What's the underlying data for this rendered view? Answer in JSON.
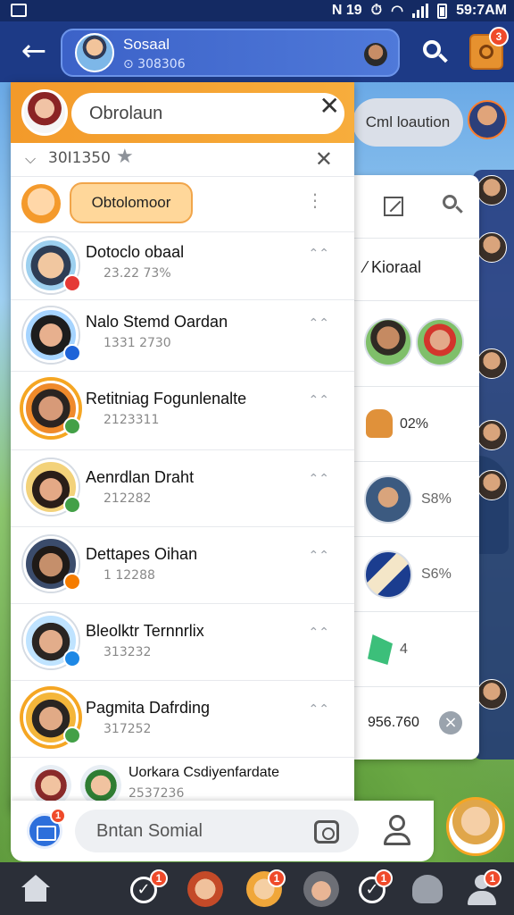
{
  "status_bar": {
    "right_text": "N 19",
    "time": "59:7AM"
  },
  "top_bar": {
    "back_icon": "arrow-left-icon",
    "chat_title": "Sosaal",
    "chat_subtitle": "⊙ 308306",
    "notification_badge": "3"
  },
  "background": {
    "bubble_text": "Cml loaution"
  },
  "panel": {
    "search_value": "Obrolaun",
    "filter_text": "30I1350",
    "pinned_bubble": "Obtolomoor",
    "contacts": [
      {
        "name": "Dotoclo obaal",
        "sub": "23.22 73%",
        "badge_color": "#e53935"
      },
      {
        "name": "Nalo Stemd Oardan",
        "sub": "1331 2730",
        "badge_color": "#1e63d8"
      },
      {
        "name": "Retitniag Fogunlenalte",
        "sub": "2123311",
        "badge_color": "#43a047"
      },
      {
        "name": "Aenrdlan Draht",
        "sub": "212282",
        "badge_color": "#43a047"
      },
      {
        "name": "Dettapes Oihan",
        "sub": "1 12288",
        "badge_color": "#f57c00"
      },
      {
        "name": "Bleolktr Ternnrlix",
        "sub": "313232",
        "badge_color": "#1e88e5"
      },
      {
        "name": "Pagmita Dafrding",
        "sub": "317252",
        "badge_color": "#43a047"
      },
      {
        "name": "Uorkara Csdiyenfardate",
        "sub": "2537236",
        "badge_color": "#43a047"
      }
    ]
  },
  "right_panel": {
    "title": "Kioraal",
    "items": [
      {
        "value": "02%"
      },
      {
        "value": "S8%"
      },
      {
        "value": "S6%"
      },
      {
        "value": "4"
      }
    ],
    "total": "956.760"
  },
  "message_bar": {
    "placeholder": "Bntan Somial",
    "mail_badge": "1"
  },
  "bottom_nav": {
    "badges": [
      "1",
      "1",
      "1",
      "1"
    ]
  },
  "colors": {
    "accent_orange": "#f39a2a",
    "top_bar": "#1d3a86",
    "badge_red": "#ef4a2a"
  }
}
